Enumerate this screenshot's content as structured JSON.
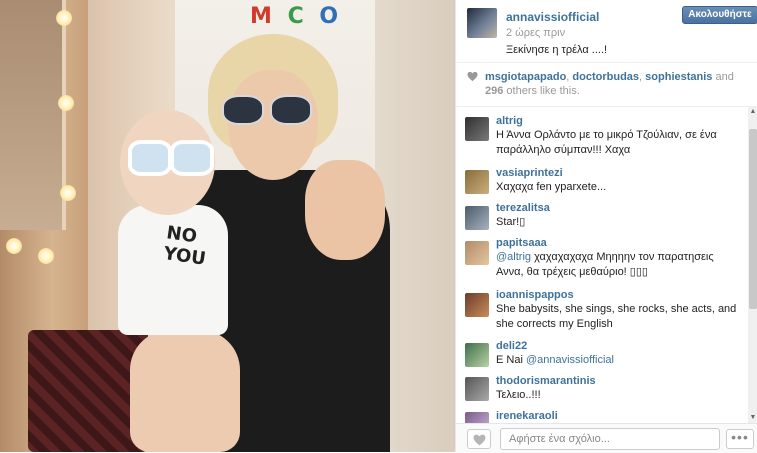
{
  "post": {
    "username": "annavissiofficial",
    "time_ago": "2 ώρες πριν",
    "caption": "Ξεκίνησε η τρέλα ....!",
    "follow_label": "Ακολουθήστε"
  },
  "photo": {
    "wall_letters": "M  C O"
  },
  "likes": {
    "users": [
      "msgiotapapado",
      "doctorbudas",
      "sophiestanis"
    ],
    "sep1": ", ",
    "sep2": ", ",
    "and_text": " and ",
    "count": "296",
    "suffix": " others like this."
  },
  "comments": [
    {
      "user": "altrig",
      "text": "Η Άννα Ορλάντο με το μικρό Τζούλιαν, σε ένα παράλληλο σύμπαν!!! Χαχα"
    },
    {
      "user": "vasiaprintezi",
      "text": "Χαχαχα fen yparxete..."
    },
    {
      "user": "terezalitsa",
      "text": "Star!▯"
    },
    {
      "user": "papitsaaa",
      "mention": "@altrig",
      "text": " χαχαχαχαχα Μηηηην τον παρατησεις Αννα, θα τρέχεις μεθαύριο! ▯▯▯"
    },
    {
      "user": "ioannispappos",
      "text": "She babysits, she sings, she rocks, she acts, and she corrects my English"
    },
    {
      "user": "deli22",
      "prefix": "E Nai ",
      "mention": "@annavissiofficial"
    },
    {
      "user": "thodorismarantinis",
      "text": "Τελειο..!!!"
    },
    {
      "user": "irenekaraoli",
      "text": ""
    }
  ],
  "footer": {
    "comment_placeholder": "Αφήστε ένα σχόλιο...",
    "more_label": "•••"
  },
  "colors": {
    "link": "#3f729b",
    "follow_button": "#4a71a0"
  }
}
